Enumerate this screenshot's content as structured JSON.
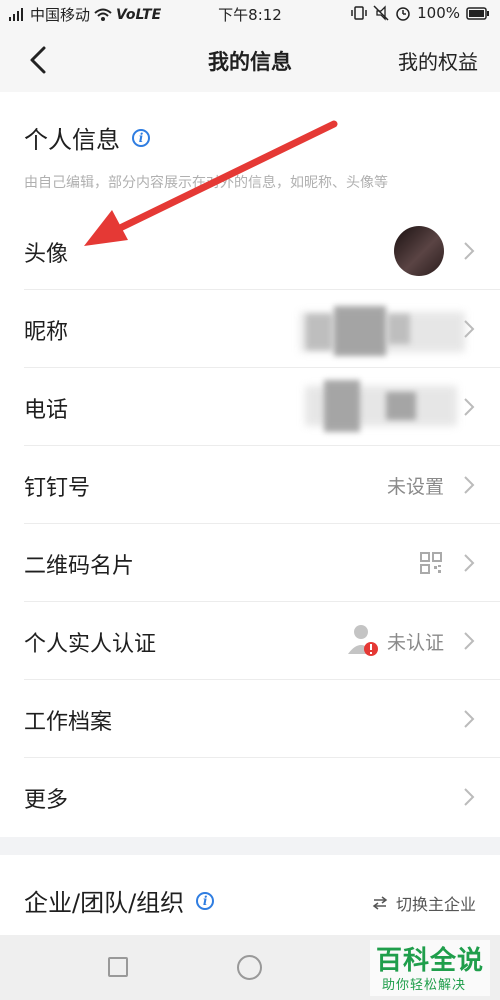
{
  "status_bar": {
    "carrier": "中国移动",
    "network": "VoLTE",
    "time": "下午8:12",
    "battery": "100%"
  },
  "nav": {
    "back_icon": "chevron-left-icon",
    "title": "我的信息",
    "right_label": "我的权益"
  },
  "personal_info": {
    "title": "个人信息",
    "description": "由自己编辑，部分内容展示在对外的信息，如昵称、头像等",
    "rows": [
      {
        "label": "头像"
      },
      {
        "label": "昵称"
      },
      {
        "label": "电话"
      },
      {
        "label": "钉钉号",
        "value": "未设置"
      },
      {
        "label": "二维码名片"
      },
      {
        "label": "个人实人认证",
        "value": "未认证"
      },
      {
        "label": "工作档案"
      },
      {
        "label": "更多"
      }
    ]
  },
  "organization": {
    "title": "企业/团队/组织",
    "switch_label": "切换主企业"
  },
  "watermark": {
    "main": "百科全说",
    "sub": "助你轻松解决"
  },
  "colors": {
    "accent_blue": "#2f7de1",
    "annotation_red": "#e53935",
    "watermark_green": "#1f9e4b"
  }
}
